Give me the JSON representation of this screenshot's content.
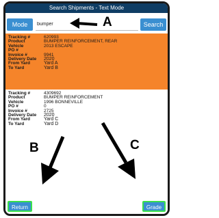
{
  "window": {
    "title": "Search Shipments - Text Mode"
  },
  "search": {
    "mode_label": "Mode",
    "query": "bumper",
    "search_label": "Search"
  },
  "results": [
    {
      "selected": true,
      "tracking_label": "Tracking #",
      "tracking": "620993",
      "product_label": "Product",
      "product": "BUMPER REINFORCEMENT, REAR",
      "vehicle_label": "Vehicle",
      "vehicle": "2013 ESCAPE",
      "po_label": "PO #",
      "po": "",
      "invoice_label": "Invoice #",
      "invoice": "9941",
      "delivery_label": "Delivery Date",
      "delivery": "2020",
      "from_label": "From Yard",
      "from": "Yard A",
      "to_label": "To Yard",
      "to": "Yard B"
    },
    {
      "selected": false,
      "tracking_label": "Tracking #",
      "tracking": "4309692",
      "product_label": "Product",
      "product": "BUMPER REINFORCEMENT",
      "vehicle_label": "Vehicle",
      "vehicle": "1996 BONNEVILLE",
      "po_label": "PO #",
      "po": "0",
      "invoice_label": "Invoice #",
      "invoice": "2725",
      "delivery_label": "Delivery Date",
      "delivery": "2020",
      "from_label": "From Yard",
      "from": "Yard C",
      "to_label": "To Yard",
      "to": "Yard D"
    }
  ],
  "footer": {
    "return_label": "Return",
    "grade_label": "Grade"
  },
  "annotations": {
    "a": "A",
    "b": "B",
    "c": "C"
  },
  "colors": {
    "titlebar": "#0f3d64",
    "button": "#3a8fd1",
    "selected_row": "#f5842a",
    "highlight_border": "#39e04a"
  }
}
